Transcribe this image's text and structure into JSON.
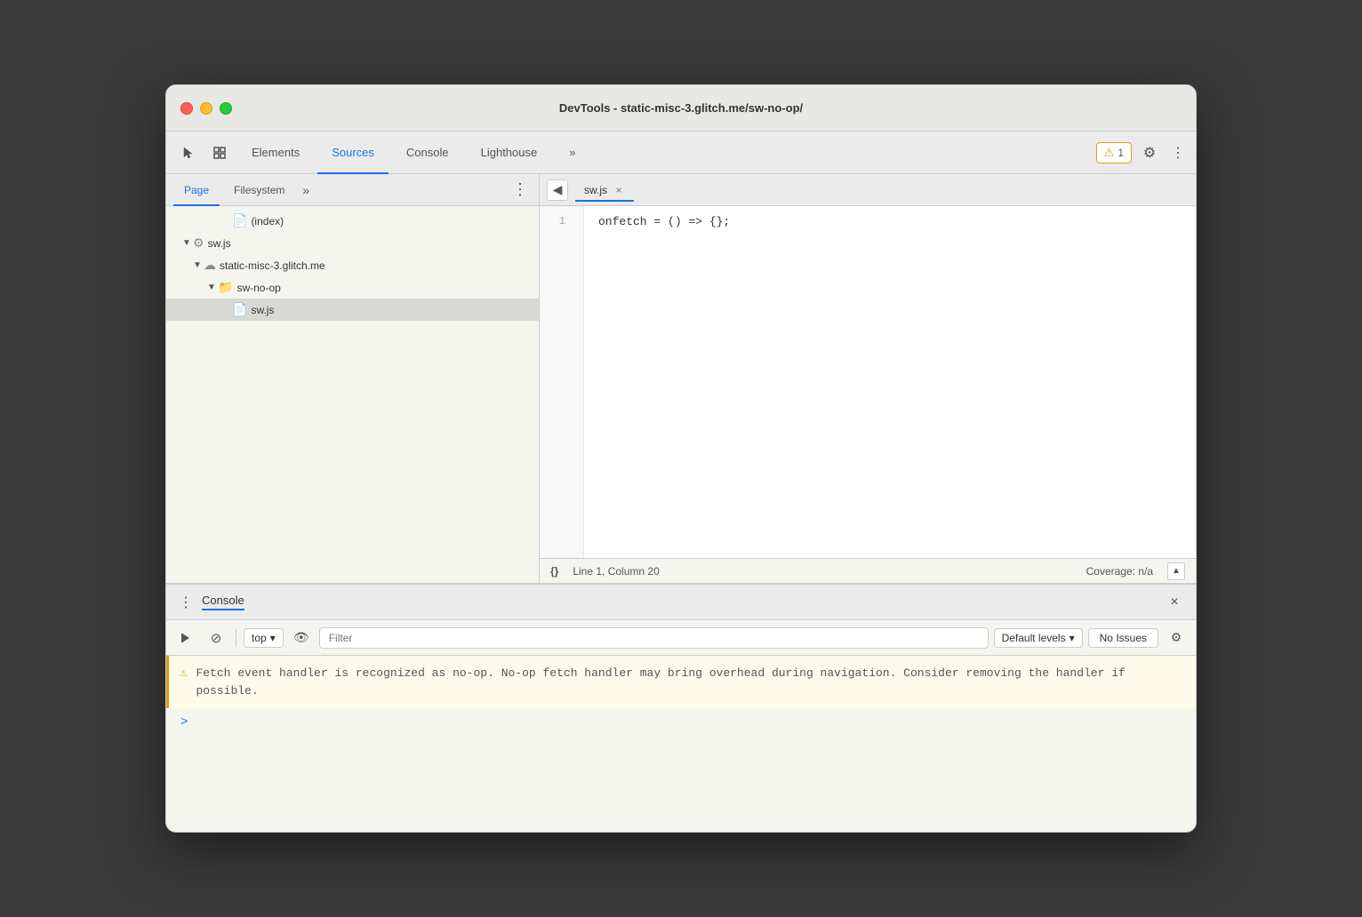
{
  "window": {
    "title": "DevTools - static-misc-3.glitch.me/sw-no-op/"
  },
  "tabbar": {
    "tabs": [
      {
        "id": "elements",
        "label": "Elements",
        "active": false
      },
      {
        "id": "sources",
        "label": "Sources",
        "active": true
      },
      {
        "id": "console",
        "label": "Console",
        "active": false
      },
      {
        "id": "lighthouse",
        "label": "Lighthouse",
        "active": false
      }
    ],
    "more_label": "»",
    "warning_count": "1",
    "more_tabs_label": "⋮"
  },
  "left_panel": {
    "tabs": [
      {
        "id": "page",
        "label": "Page",
        "active": true
      },
      {
        "id": "filesystem",
        "label": "Filesystem",
        "active": false
      }
    ],
    "more_label": "»",
    "options_label": "⋮",
    "tree": [
      {
        "id": "index",
        "label": "(index)",
        "indent": 3,
        "icon": "doc",
        "arrow": false
      },
      {
        "id": "sw-js-root",
        "label": "sw.js",
        "indent": 1,
        "icon": "gear",
        "arrow": "down",
        "expanded": true
      },
      {
        "id": "domain",
        "label": "static-misc-3.glitch.me",
        "indent": 2,
        "icon": "cloud",
        "arrow": "down",
        "expanded": true
      },
      {
        "id": "sw-no-op-folder",
        "label": "sw-no-op",
        "indent": 3,
        "icon": "folder",
        "arrow": "down",
        "expanded": true
      },
      {
        "id": "sw-js-file",
        "label": "sw.js",
        "indent": 4,
        "icon": "js",
        "arrow": false,
        "selected": true
      }
    ]
  },
  "editor": {
    "back_btn": "◀",
    "file_tab": "sw.js",
    "close_icon": "×",
    "lines": [
      {
        "num": "1",
        "code": "onfetch = () => {};"
      }
    ]
  },
  "status_bar": {
    "braces_label": "{}",
    "position": "Line 1, Column 20",
    "coverage_label": "Coverage: n/a",
    "scroll_icon": "▲"
  },
  "console_panel": {
    "dots_label": "⋮",
    "title": "Console",
    "close_icon": "×",
    "toolbar": {
      "play_icon": "▷",
      "block_icon": "⊘",
      "top_label": "top",
      "dropdown_icon": "▾",
      "eye_icon": "👁",
      "filter_placeholder": "Filter",
      "default_levels_label": "Default levels",
      "default_levels_arrow": "▾",
      "no_issues_label": "No Issues",
      "gear_icon": "⚙"
    },
    "warning_message": "Fetch event handler is recognized as no-op. No-op fetch handler may bring overhead during navigation. Consider removing the handler if possible.",
    "prompt_chevron": ">"
  }
}
